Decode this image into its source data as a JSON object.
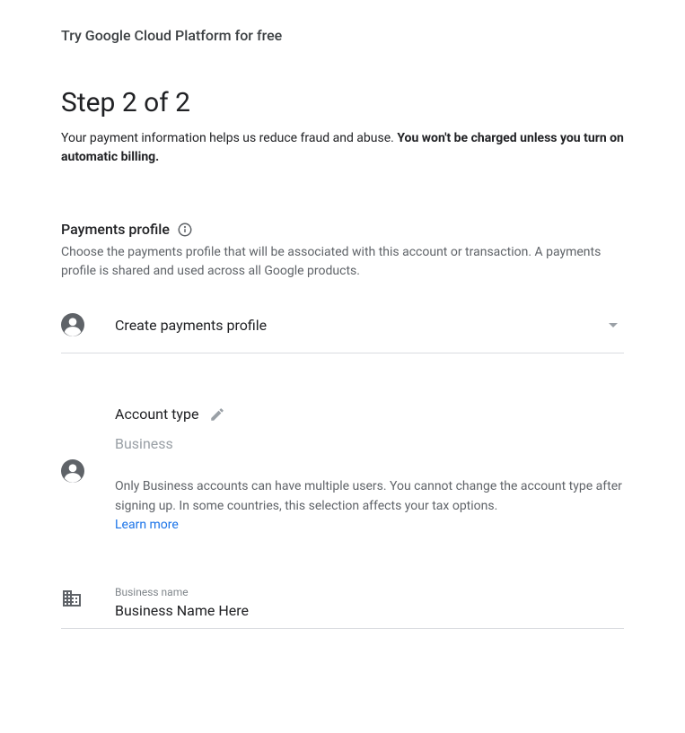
{
  "pageTitle": "Try Google Cloud Platform for free",
  "stepHeading": "Step 2 of 2",
  "stepDesc": {
    "lead": "Your payment information helps us reduce fraud and abuse. ",
    "bold": "You won't be charged unless you turn on automatic billing."
  },
  "paymentsProfile": {
    "title": "Payments profile",
    "desc": "Choose the payments profile that will be associated with this account or transaction. A payments profile is shared and used across all Google products.",
    "dropdownLabel": "Create payments profile"
  },
  "accountType": {
    "label": "Account type",
    "value": "Business",
    "note": "Only Business accounts can have multiple users. You cannot change the account type after signing up. In some countries, this selection affects your tax options.",
    "learnMore": "Learn more"
  },
  "businessName": {
    "label": "Business name",
    "value": "Business Name Here"
  }
}
